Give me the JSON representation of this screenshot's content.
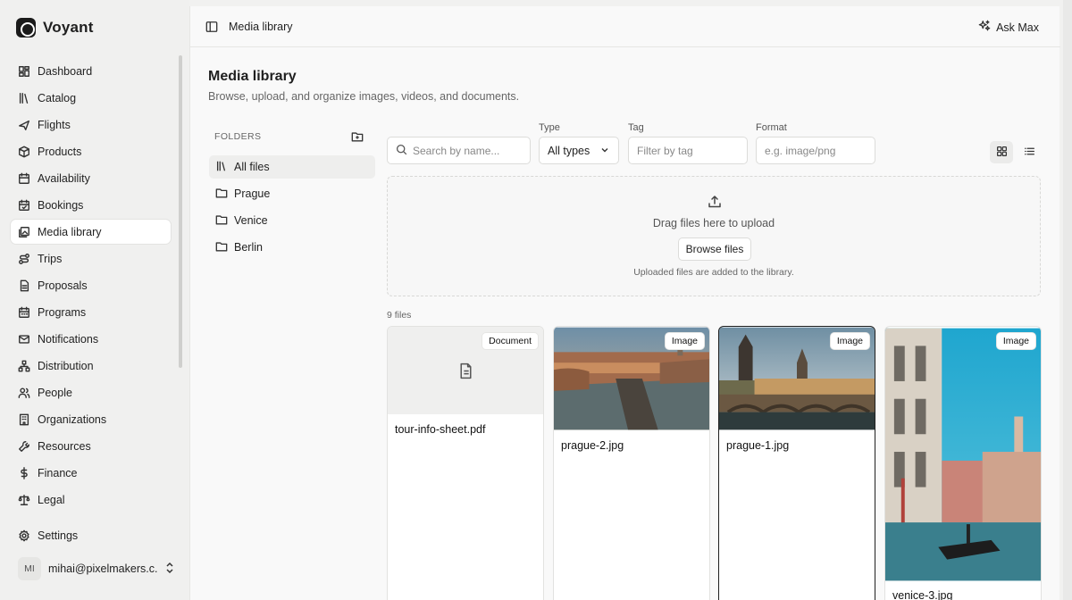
{
  "app": {
    "name": "Voyant"
  },
  "sidebar": {
    "items": [
      {
        "label": "Dashboard",
        "icon": "dashboard-icon"
      },
      {
        "label": "Catalog",
        "icon": "library-icon"
      },
      {
        "label": "Flights",
        "icon": "plane-icon"
      },
      {
        "label": "Products",
        "icon": "box-icon"
      },
      {
        "label": "Availability",
        "icon": "calendar-icon"
      },
      {
        "label": "Bookings",
        "icon": "calendar-check-icon"
      },
      {
        "label": "Media library",
        "icon": "images-icon",
        "active": true
      },
      {
        "label": "Trips",
        "icon": "route-icon"
      },
      {
        "label": "Proposals",
        "icon": "file-text-icon"
      },
      {
        "label": "Programs",
        "icon": "calendar-days-icon"
      },
      {
        "label": "Notifications",
        "icon": "mail-icon"
      },
      {
        "label": "Distribution",
        "icon": "network-icon"
      },
      {
        "label": "People",
        "icon": "users-icon"
      },
      {
        "label": "Organizations",
        "icon": "building-icon"
      },
      {
        "label": "Resources",
        "icon": "wrench-icon"
      },
      {
        "label": "Finance",
        "icon": "dollar-icon"
      },
      {
        "label": "Legal",
        "icon": "scale-icon"
      }
    ],
    "settings": "Settings",
    "user": {
      "initials": "MI",
      "email": "mihai@pixelmakers.c..."
    }
  },
  "topbar": {
    "breadcrumb": "Media library",
    "ask": "Ask Max"
  },
  "page": {
    "title": "Media library",
    "subtitle": "Browse, upload, and organize images, videos, and documents."
  },
  "folders": {
    "heading": "FOLDERS",
    "items": [
      {
        "label": "All files",
        "active": true
      },
      {
        "label": "Prague"
      },
      {
        "label": "Venice"
      },
      {
        "label": "Berlin"
      }
    ]
  },
  "filters": {
    "search_placeholder": "Search by name...",
    "type_label": "Type",
    "type_value": "All types",
    "tag_label": "Tag",
    "tag_placeholder": "Filter by tag",
    "format_label": "Format",
    "format_placeholder": "e.g. image/png"
  },
  "upload": {
    "text": "Drag files here to upload",
    "button": "Browse files",
    "note": "Uploaded files are added to the library."
  },
  "files": {
    "count": "9 files",
    "items": [
      {
        "name": "tour-info-sheet.pdf",
        "badge": "Document"
      },
      {
        "name": "prague-2.jpg",
        "badge": "Image"
      },
      {
        "name": "prague-1.jpg",
        "badge": "Image",
        "selected": true
      },
      {
        "name": "venice-3.jpg",
        "badge": "Image"
      }
    ]
  },
  "colors": {
    "sidebar_bg": "#f0f0ef",
    "main_bg": "#f9f9f9",
    "accent": "#1f1f1f"
  }
}
